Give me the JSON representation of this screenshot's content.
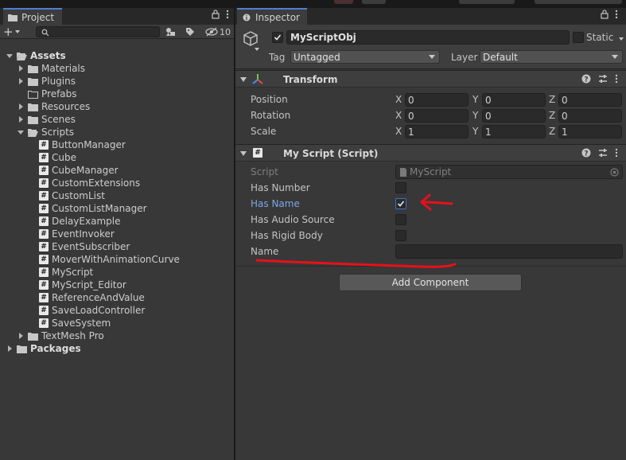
{
  "project": {
    "tab_label": "Project",
    "hidden_count": "10",
    "search": {
      "value": "",
      "placeholder": ""
    },
    "tree": [
      {
        "label": "Assets",
        "depth": 0,
        "bold": true,
        "expanded": true,
        "kind": "folder-open"
      },
      {
        "label": "Materials",
        "depth": 1,
        "arrow": true,
        "kind": "folder"
      },
      {
        "label": "Plugins",
        "depth": 1,
        "arrow": true,
        "kind": "folder"
      },
      {
        "label": "Prefabs",
        "depth": 1,
        "arrow": false,
        "kind": "folder-empty"
      },
      {
        "label": "Resources",
        "depth": 1,
        "arrow": true,
        "kind": "folder"
      },
      {
        "label": "Scenes",
        "depth": 1,
        "arrow": true,
        "kind": "folder"
      },
      {
        "label": "Scripts",
        "depth": 1,
        "arrow": true,
        "expanded": true,
        "kind": "folder-open"
      },
      {
        "label": "ButtonManager",
        "depth": 2,
        "kind": "script"
      },
      {
        "label": "Cube",
        "depth": 2,
        "kind": "script"
      },
      {
        "label": "CubeManager",
        "depth": 2,
        "kind": "script"
      },
      {
        "label": "CustomExtensions",
        "depth": 2,
        "kind": "script"
      },
      {
        "label": "CustomList",
        "depth": 2,
        "kind": "script"
      },
      {
        "label": "CustomListManager",
        "depth": 2,
        "kind": "script"
      },
      {
        "label": "DelayExample",
        "depth": 2,
        "kind": "script"
      },
      {
        "label": "EventInvoker",
        "depth": 2,
        "kind": "script"
      },
      {
        "label": "EventSubscriber",
        "depth": 2,
        "kind": "script"
      },
      {
        "label": "MoverWithAnimationCurve",
        "depth": 2,
        "kind": "script"
      },
      {
        "label": "MyScript",
        "depth": 2,
        "kind": "script"
      },
      {
        "label": "MyScript_Editor",
        "depth": 2,
        "kind": "script"
      },
      {
        "label": "ReferenceAndValue",
        "depth": 2,
        "kind": "script"
      },
      {
        "label": "SaveLoadController",
        "depth": 2,
        "kind": "script"
      },
      {
        "label": "SaveSystem",
        "depth": 2,
        "kind": "script"
      },
      {
        "label": "TextMesh Pro",
        "depth": 1,
        "arrow": true,
        "kind": "folder"
      },
      {
        "label": "Packages",
        "depth": 0,
        "bold": true,
        "arrow": true,
        "kind": "folder"
      }
    ]
  },
  "inspector": {
    "tab_label": "Inspector",
    "object": {
      "name": "MyScriptObj",
      "active": true,
      "static_label": "Static",
      "tag_label": "Tag",
      "tag_value": "Untagged",
      "layer_label": "Layer",
      "layer_value": "Default"
    },
    "transform": {
      "title": "Transform",
      "rows": [
        {
          "label": "Position",
          "x": "0",
          "y": "0",
          "z": "0"
        },
        {
          "label": "Rotation",
          "x": "0",
          "y": "0",
          "z": "0"
        },
        {
          "label": "Scale",
          "x": "1",
          "y": "1",
          "z": "1"
        }
      ],
      "axis_x": "X",
      "axis_y": "Y",
      "axis_z": "Z"
    },
    "my_script": {
      "title": "My Script (Script)",
      "script_label": "Script",
      "script_value": "MyScript",
      "fields": [
        {
          "label": "Has Number",
          "checked": false,
          "highlight": false
        },
        {
          "label": "Has Name",
          "checked": true,
          "highlight": true
        },
        {
          "label": "Has Audio Source",
          "checked": false,
          "highlight": false
        },
        {
          "label": "Has Rigid Body",
          "checked": false,
          "highlight": false
        }
      ],
      "name_label": "Name",
      "name_value": ""
    },
    "add_component_label": "Add Component"
  },
  "colors": {
    "panel_bg": "#383838",
    "header_bg": "#3e3e3e",
    "field_bg": "#2a2a2a",
    "tab_accent": "#4d7fd4",
    "highlight_text": "#7ba6e8",
    "annotation_red": "#e8101a"
  },
  "icons": {
    "add": "plus-icon",
    "search": "search-icon",
    "lock": "lock-icon",
    "menu": "kebab-menu-icon",
    "help": "help-icon",
    "settings": "preset-sliders-icon",
    "gameobject": "cube-icon",
    "transform": "transform-axes-icon",
    "script": "csharp-script-icon"
  }
}
